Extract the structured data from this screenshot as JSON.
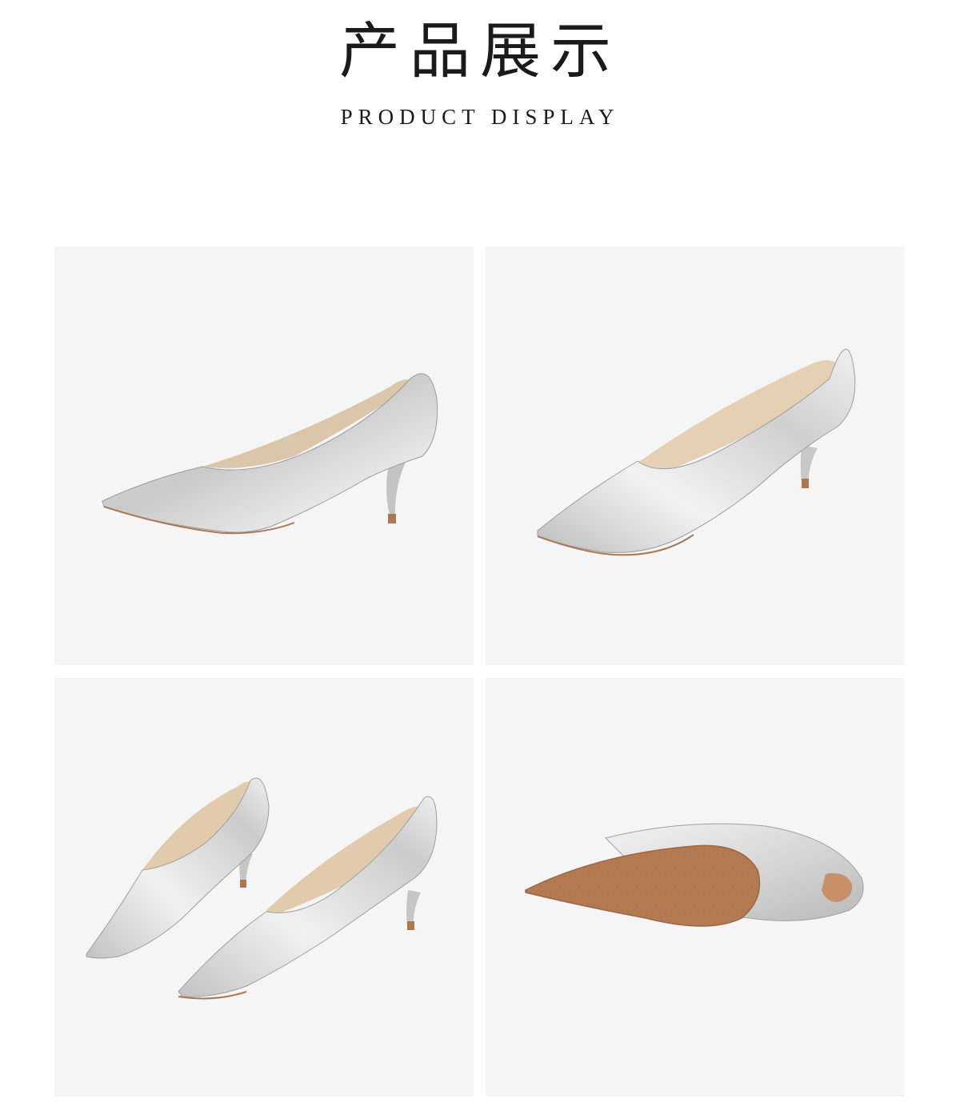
{
  "header": {
    "title_zh": "产品展示",
    "title_en": "PRODUCT DISPLAY"
  },
  "gallery": {
    "panels": [
      {
        "view": "side-view-pump",
        "colors": {
          "upper": "#d9d9d9",
          "lining": "#dcc6aa",
          "heel_tip": "#b0764f"
        }
      },
      {
        "view": "three-quarter-view-pump",
        "colors": {
          "upper": "#dcdcdc",
          "lining": "#e6d0b4",
          "heel_tip": "#b0764f"
        }
      },
      {
        "view": "pair-front-view",
        "colors": {
          "upper": "#d8d8d8",
          "lining": "#e2cbad",
          "heel_tip": "#b0764f"
        }
      },
      {
        "view": "sole-view",
        "colors": {
          "upper": "#dedede",
          "sole": "#b47a52",
          "heel_cap": "#c89068"
        }
      }
    ]
  },
  "colors": {
    "background": "#ffffff",
    "panel_background": "#f5f5f5",
    "title": "#1a1a1a"
  }
}
